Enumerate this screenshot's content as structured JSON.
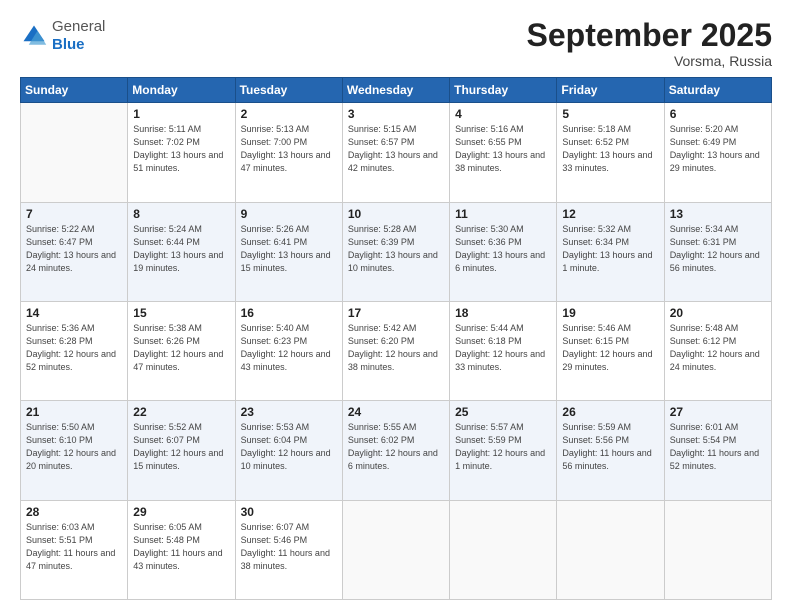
{
  "header": {
    "logo_general": "General",
    "logo_blue": "Blue",
    "month_title": "September 2025",
    "location": "Vorsma, Russia"
  },
  "weekdays": [
    "Sunday",
    "Monday",
    "Tuesday",
    "Wednesday",
    "Thursday",
    "Friday",
    "Saturday"
  ],
  "weeks": [
    [
      {
        "day": "",
        "sunrise": "",
        "sunset": "",
        "daylight": ""
      },
      {
        "day": "1",
        "sunrise": "Sunrise: 5:11 AM",
        "sunset": "Sunset: 7:02 PM",
        "daylight": "Daylight: 13 hours and 51 minutes."
      },
      {
        "day": "2",
        "sunrise": "Sunrise: 5:13 AM",
        "sunset": "Sunset: 7:00 PM",
        "daylight": "Daylight: 13 hours and 47 minutes."
      },
      {
        "day": "3",
        "sunrise": "Sunrise: 5:15 AM",
        "sunset": "Sunset: 6:57 PM",
        "daylight": "Daylight: 13 hours and 42 minutes."
      },
      {
        "day": "4",
        "sunrise": "Sunrise: 5:16 AM",
        "sunset": "Sunset: 6:55 PM",
        "daylight": "Daylight: 13 hours and 38 minutes."
      },
      {
        "day": "5",
        "sunrise": "Sunrise: 5:18 AM",
        "sunset": "Sunset: 6:52 PM",
        "daylight": "Daylight: 13 hours and 33 minutes."
      },
      {
        "day": "6",
        "sunrise": "Sunrise: 5:20 AM",
        "sunset": "Sunset: 6:49 PM",
        "daylight": "Daylight: 13 hours and 29 minutes."
      }
    ],
    [
      {
        "day": "7",
        "sunrise": "Sunrise: 5:22 AM",
        "sunset": "Sunset: 6:47 PM",
        "daylight": "Daylight: 13 hours and 24 minutes."
      },
      {
        "day": "8",
        "sunrise": "Sunrise: 5:24 AM",
        "sunset": "Sunset: 6:44 PM",
        "daylight": "Daylight: 13 hours and 19 minutes."
      },
      {
        "day": "9",
        "sunrise": "Sunrise: 5:26 AM",
        "sunset": "Sunset: 6:41 PM",
        "daylight": "Daylight: 13 hours and 15 minutes."
      },
      {
        "day": "10",
        "sunrise": "Sunrise: 5:28 AM",
        "sunset": "Sunset: 6:39 PM",
        "daylight": "Daylight: 13 hours and 10 minutes."
      },
      {
        "day": "11",
        "sunrise": "Sunrise: 5:30 AM",
        "sunset": "Sunset: 6:36 PM",
        "daylight": "Daylight: 13 hours and 6 minutes."
      },
      {
        "day": "12",
        "sunrise": "Sunrise: 5:32 AM",
        "sunset": "Sunset: 6:34 PM",
        "daylight": "Daylight: 13 hours and 1 minute."
      },
      {
        "day": "13",
        "sunrise": "Sunrise: 5:34 AM",
        "sunset": "Sunset: 6:31 PM",
        "daylight": "Daylight: 12 hours and 56 minutes."
      }
    ],
    [
      {
        "day": "14",
        "sunrise": "Sunrise: 5:36 AM",
        "sunset": "Sunset: 6:28 PM",
        "daylight": "Daylight: 12 hours and 52 minutes."
      },
      {
        "day": "15",
        "sunrise": "Sunrise: 5:38 AM",
        "sunset": "Sunset: 6:26 PM",
        "daylight": "Daylight: 12 hours and 47 minutes."
      },
      {
        "day": "16",
        "sunrise": "Sunrise: 5:40 AM",
        "sunset": "Sunset: 6:23 PM",
        "daylight": "Daylight: 12 hours and 43 minutes."
      },
      {
        "day": "17",
        "sunrise": "Sunrise: 5:42 AM",
        "sunset": "Sunset: 6:20 PM",
        "daylight": "Daylight: 12 hours and 38 minutes."
      },
      {
        "day": "18",
        "sunrise": "Sunrise: 5:44 AM",
        "sunset": "Sunset: 6:18 PM",
        "daylight": "Daylight: 12 hours and 33 minutes."
      },
      {
        "day": "19",
        "sunrise": "Sunrise: 5:46 AM",
        "sunset": "Sunset: 6:15 PM",
        "daylight": "Daylight: 12 hours and 29 minutes."
      },
      {
        "day": "20",
        "sunrise": "Sunrise: 5:48 AM",
        "sunset": "Sunset: 6:12 PM",
        "daylight": "Daylight: 12 hours and 24 minutes."
      }
    ],
    [
      {
        "day": "21",
        "sunrise": "Sunrise: 5:50 AM",
        "sunset": "Sunset: 6:10 PM",
        "daylight": "Daylight: 12 hours and 20 minutes."
      },
      {
        "day": "22",
        "sunrise": "Sunrise: 5:52 AM",
        "sunset": "Sunset: 6:07 PM",
        "daylight": "Daylight: 12 hours and 15 minutes."
      },
      {
        "day": "23",
        "sunrise": "Sunrise: 5:53 AM",
        "sunset": "Sunset: 6:04 PM",
        "daylight": "Daylight: 12 hours and 10 minutes."
      },
      {
        "day": "24",
        "sunrise": "Sunrise: 5:55 AM",
        "sunset": "Sunset: 6:02 PM",
        "daylight": "Daylight: 12 hours and 6 minutes."
      },
      {
        "day": "25",
        "sunrise": "Sunrise: 5:57 AM",
        "sunset": "Sunset: 5:59 PM",
        "daylight": "Daylight: 12 hours and 1 minute."
      },
      {
        "day": "26",
        "sunrise": "Sunrise: 5:59 AM",
        "sunset": "Sunset: 5:56 PM",
        "daylight": "Daylight: 11 hours and 56 minutes."
      },
      {
        "day": "27",
        "sunrise": "Sunrise: 6:01 AM",
        "sunset": "Sunset: 5:54 PM",
        "daylight": "Daylight: 11 hours and 52 minutes."
      }
    ],
    [
      {
        "day": "28",
        "sunrise": "Sunrise: 6:03 AM",
        "sunset": "Sunset: 5:51 PM",
        "daylight": "Daylight: 11 hours and 47 minutes."
      },
      {
        "day": "29",
        "sunrise": "Sunrise: 6:05 AM",
        "sunset": "Sunset: 5:48 PM",
        "daylight": "Daylight: 11 hours and 43 minutes."
      },
      {
        "day": "30",
        "sunrise": "Sunrise: 6:07 AM",
        "sunset": "Sunset: 5:46 PM",
        "daylight": "Daylight: 11 hours and 38 minutes."
      },
      {
        "day": "",
        "sunrise": "",
        "sunset": "",
        "daylight": ""
      },
      {
        "day": "",
        "sunrise": "",
        "sunset": "",
        "daylight": ""
      },
      {
        "day": "",
        "sunrise": "",
        "sunset": "",
        "daylight": ""
      },
      {
        "day": "",
        "sunrise": "",
        "sunset": "",
        "daylight": ""
      }
    ]
  ]
}
